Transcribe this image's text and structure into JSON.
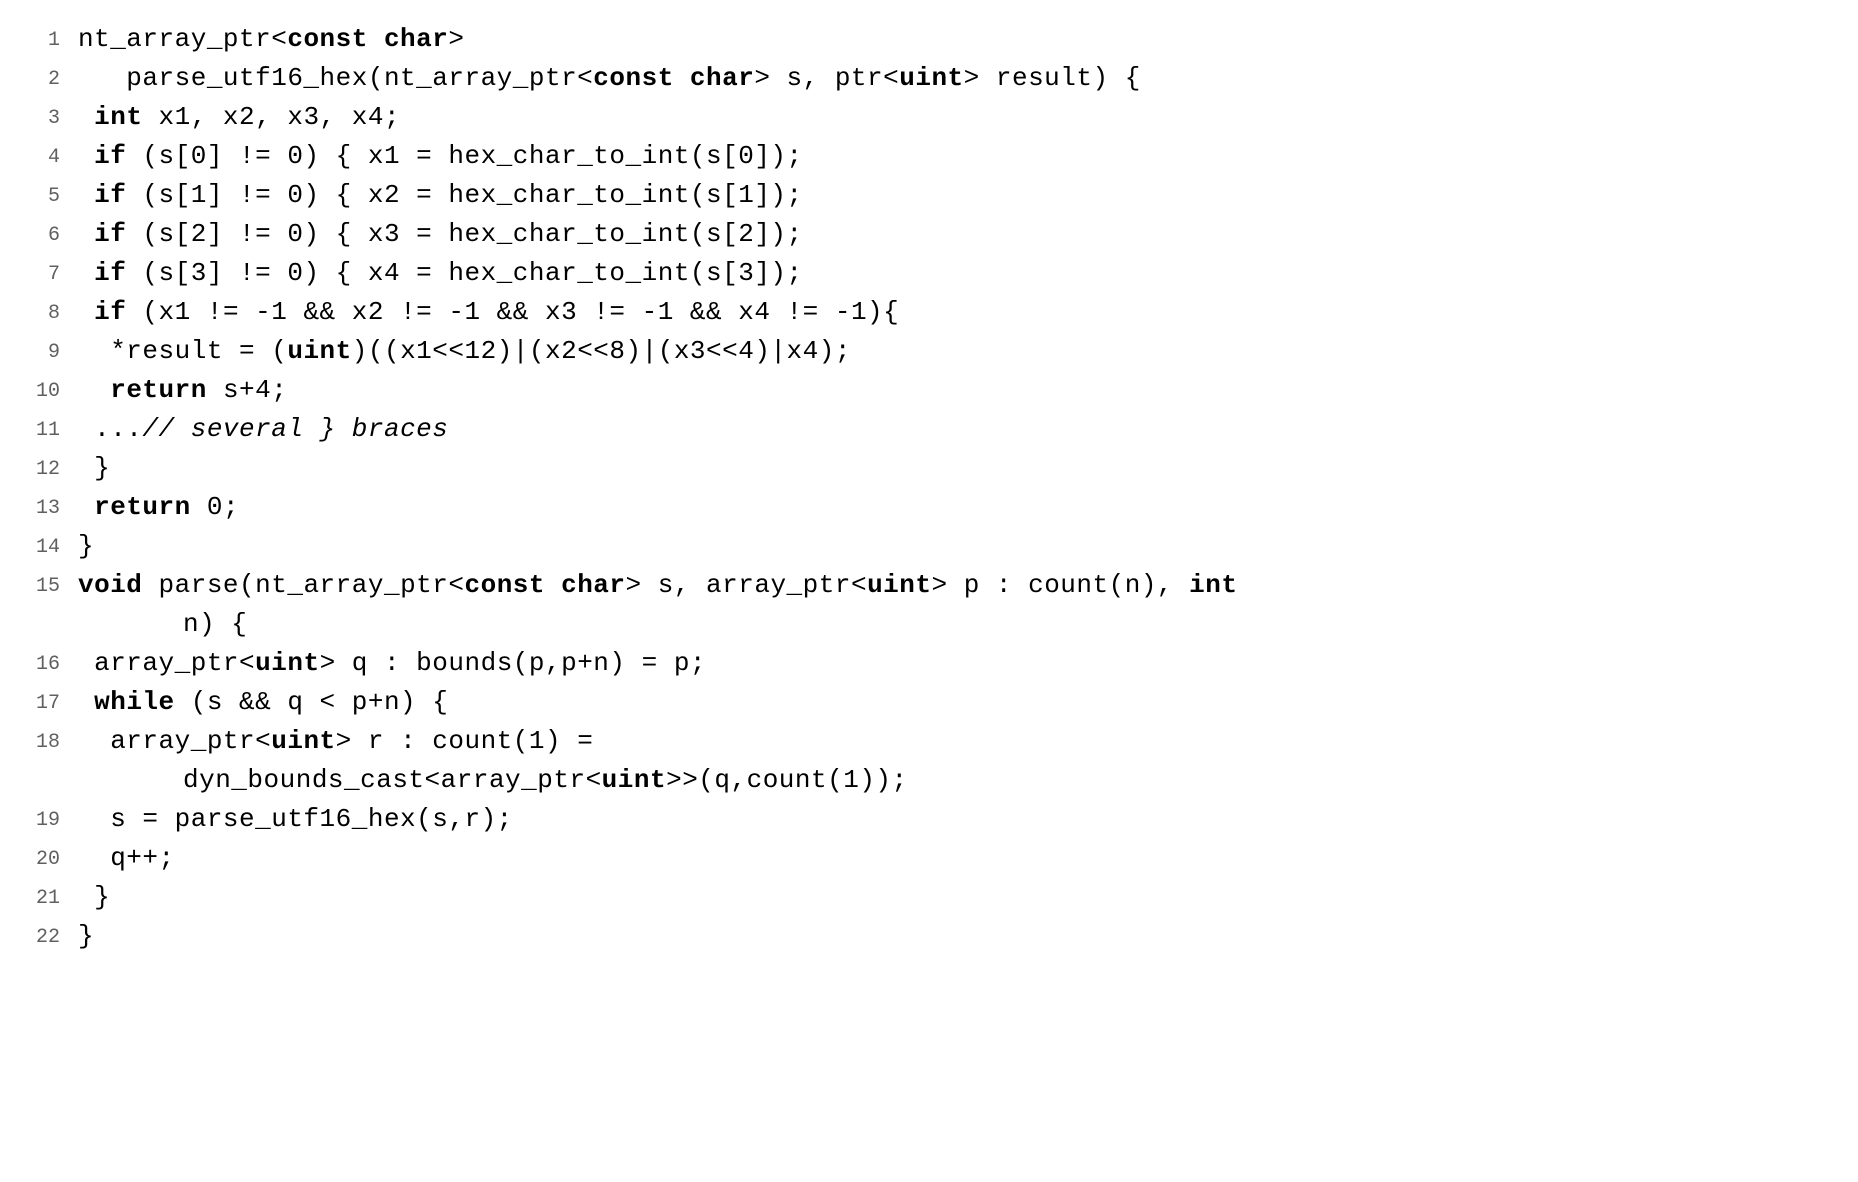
{
  "lines": [
    {
      "num": "1",
      "segments": [
        {
          "t": "nt_array_ptr<"
        },
        {
          "t": "const char",
          "c": "kw"
        },
        {
          "t": ">"
        }
      ]
    },
    {
      "num": "2",
      "segments": [
        {
          "t": "   parse_utf16_hex(nt_array_ptr<"
        },
        {
          "t": "const char",
          "c": "kw"
        },
        {
          "t": "> s, ptr<"
        },
        {
          "t": "uint",
          "c": "kw"
        },
        {
          "t": "> result) {"
        }
      ]
    },
    {
      "num": "3",
      "segments": [
        {
          "t": " "
        },
        {
          "t": "int",
          "c": "kw"
        },
        {
          "t": " x1, x2, x3, x4;"
        }
      ]
    },
    {
      "num": "4",
      "segments": [
        {
          "t": " "
        },
        {
          "t": "if",
          "c": "kw"
        },
        {
          "t": " (s[0] != 0) { x1 = hex_char_to_int(s[0]);"
        }
      ]
    },
    {
      "num": "5",
      "segments": [
        {
          "t": " "
        },
        {
          "t": "if",
          "c": "kw"
        },
        {
          "t": " (s[1] != 0) { x2 = hex_char_to_int(s[1]);"
        }
      ]
    },
    {
      "num": "6",
      "segments": [
        {
          "t": " "
        },
        {
          "t": "if",
          "c": "kw"
        },
        {
          "t": " (s[2] != 0) { x3 = hex_char_to_int(s[2]);"
        }
      ]
    },
    {
      "num": "7",
      "segments": [
        {
          "t": " "
        },
        {
          "t": "if",
          "c": "kw"
        },
        {
          "t": " (s[3] != 0) { x4 = hex_char_to_int(s[3]);"
        }
      ]
    },
    {
      "num": "8",
      "segments": [
        {
          "t": " "
        },
        {
          "t": "if",
          "c": "kw"
        },
        {
          "t": " (x1 != -1 && x2 != -1 && x3 != -1 && x4 != -1){"
        }
      ]
    },
    {
      "num": "9",
      "segments": [
        {
          "t": "  *result = ("
        },
        {
          "t": "uint",
          "c": "kw"
        },
        {
          "t": ")((x1<<12)|(x2<<8)|(x3<<4)|x4);"
        }
      ]
    },
    {
      "num": "10",
      "segments": [
        {
          "t": "  "
        },
        {
          "t": "return",
          "c": "kw"
        },
        {
          "t": " s+4;"
        }
      ]
    },
    {
      "num": "11",
      "segments": [
        {
          "t": " ..."
        },
        {
          "t": "// several } braces",
          "c": "cm"
        }
      ]
    },
    {
      "num": "12",
      "segments": [
        {
          "t": " }"
        }
      ]
    },
    {
      "num": "13",
      "segments": [
        {
          "t": " "
        },
        {
          "t": "return",
          "c": "kw"
        },
        {
          "t": " 0;"
        }
      ]
    },
    {
      "num": "14",
      "segments": [
        {
          "t": "}"
        }
      ]
    },
    {
      "num": "15",
      "segments": [
        {
          "t": ""
        },
        {
          "t": "void",
          "c": "kw"
        },
        {
          "t": " parse(nt_array_ptr<"
        },
        {
          "t": "const char",
          "c": "kw"
        },
        {
          "t": "> s, array_ptr<"
        },
        {
          "t": "uint",
          "c": "kw"
        },
        {
          "t": "> p : count(n), "
        },
        {
          "t": "int",
          "c": "kw"
        }
      ]
    },
    {
      "num": "",
      "cont": true,
      "segments": [
        {
          "t": "n) {"
        }
      ]
    },
    {
      "num": "16",
      "segments": [
        {
          "t": " array_ptr<"
        },
        {
          "t": "uint",
          "c": "kw"
        },
        {
          "t": "> q : bounds(p,p+n) = p;"
        }
      ]
    },
    {
      "num": "17",
      "segments": [
        {
          "t": " "
        },
        {
          "t": "while",
          "c": "kw"
        },
        {
          "t": " (s && q < p+n) {"
        }
      ]
    },
    {
      "num": "18",
      "segments": [
        {
          "t": "  array_ptr<"
        },
        {
          "t": "uint",
          "c": "kw"
        },
        {
          "t": "> r : count(1) ="
        }
      ]
    },
    {
      "num": "",
      "cont": true,
      "segments": [
        {
          "t": "dyn_bounds_cast<array_ptr<"
        },
        {
          "t": "uint",
          "c": "kw"
        },
        {
          "t": ">>(q,count(1));"
        }
      ]
    },
    {
      "num": "19",
      "segments": [
        {
          "t": "  s = parse_utf16_hex(s,r);"
        }
      ]
    },
    {
      "num": "20",
      "segments": [
        {
          "t": "  q++;"
        }
      ]
    },
    {
      "num": "21",
      "segments": [
        {
          "t": " }"
        }
      ]
    },
    {
      "num": "22",
      "segments": [
        {
          "t": "}"
        }
      ]
    }
  ]
}
